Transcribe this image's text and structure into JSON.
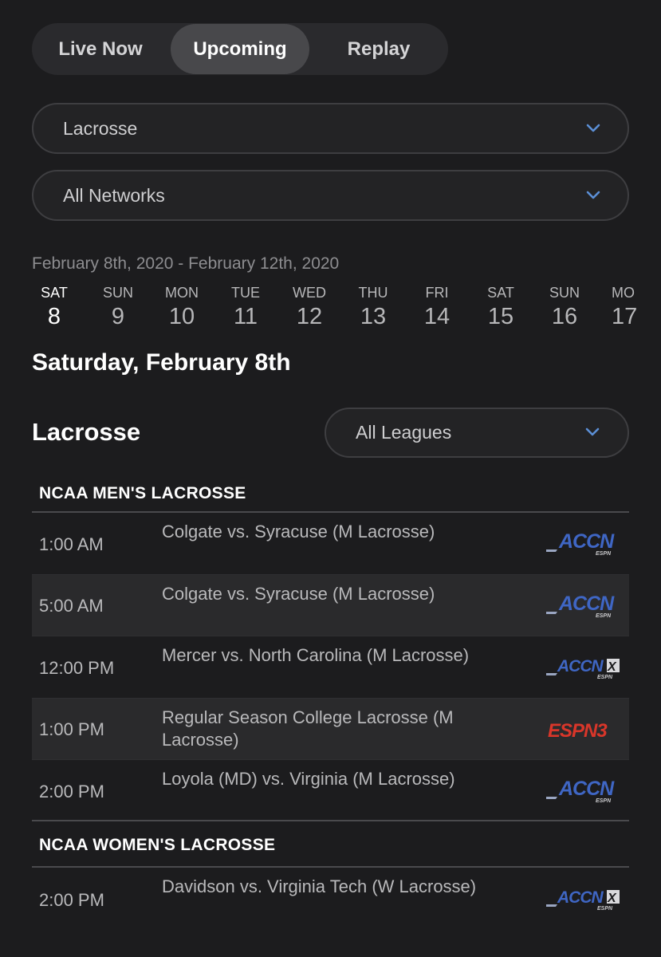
{
  "tabs": [
    {
      "label": "Live Now"
    },
    {
      "label": "Upcoming"
    },
    {
      "label": "Replay"
    }
  ],
  "active_tab": "Upcoming",
  "filters": {
    "sport": "Lacrosse",
    "network": "All Networks"
  },
  "date_range": "February 8th, 2020 - February 12th, 2020",
  "days": [
    {
      "dow": "SAT",
      "num": "8"
    },
    {
      "dow": "SUN",
      "num": "9"
    },
    {
      "dow": "MON",
      "num": "10"
    },
    {
      "dow": "TUE",
      "num": "11"
    },
    {
      "dow": "WED",
      "num": "12"
    },
    {
      "dow": "THU",
      "num": "13"
    },
    {
      "dow": "FRI",
      "num": "14"
    },
    {
      "dow": "SAT",
      "num": "15"
    },
    {
      "dow": "SUN",
      "num": "16"
    },
    {
      "dow": "MO",
      "num": "17"
    }
  ],
  "selected_day_heading": "Saturday, February 8th",
  "sport_heading": "Lacrosse",
  "league_filter": "All Leagues",
  "leagues": [
    {
      "name": "NCAA MEN'S LACROSSE",
      "events": [
        {
          "time": "1:00 AM",
          "title": "Colgate vs. Syracuse (M Lacrosse)",
          "network": "ACCN"
        },
        {
          "time": "5:00 AM",
          "title": "Colgate vs. Syracuse (M Lacrosse)",
          "network": "ACCN"
        },
        {
          "time": "12:00 PM",
          "title": "Mercer vs. North Carolina (M Lacrosse)",
          "network": "ACCNX"
        },
        {
          "time": "1:00 PM",
          "title": "Regular Season College Lacrosse (M Lacrosse)",
          "network": "ESPN3"
        },
        {
          "time": "2:00 PM",
          "title": "Loyola (MD) vs. Virginia (M Lacrosse)",
          "network": "ACCN"
        }
      ]
    },
    {
      "name": "NCAA WOMEN'S LACROSSE",
      "events": [
        {
          "time": "2:00 PM",
          "title": "Davidson vs. Virginia Tech (W Lacrosse)",
          "network": "ACCNX"
        }
      ]
    }
  ],
  "logos": {
    "ACCN": {
      "text": "ACCN",
      "sub": "ESPN"
    },
    "ACCNX": {
      "text": "ACCN",
      "x": "X",
      "sub": "ESPN"
    },
    "ESPN3": {
      "text": "ESPN3"
    }
  },
  "colors": {
    "background": "#1c1c1e",
    "accent_chevron": "#5b8fd6",
    "accn_blue": "#3f66c4",
    "espn_red": "#d8362a"
  }
}
